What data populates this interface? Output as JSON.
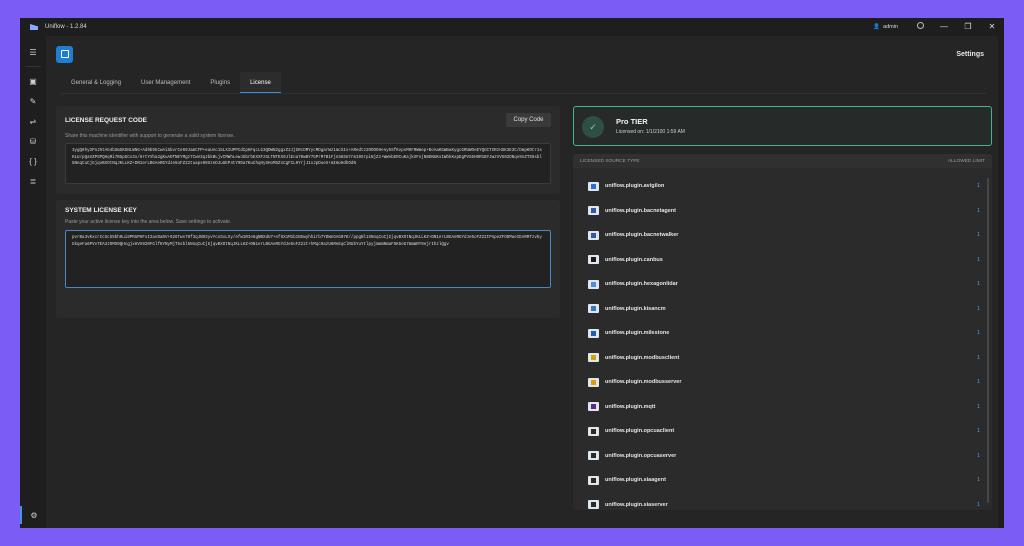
{
  "app": {
    "title": "Uniflow - 1.2.84"
  },
  "titlebar": {
    "user": "admin",
    "minimize": "—",
    "restore": "❐",
    "close": "✕"
  },
  "sidebar": {
    "items": [
      "☰",
      "▣",
      "✎",
      "⇌",
      "⛁",
      "{ }",
      "≣"
    ],
    "settings": "⚙"
  },
  "header": {
    "title": "Settings"
  },
  "tabs": [
    "General & Logging",
    "User Management",
    "Plugins",
    "License"
  ],
  "license_request": {
    "title": "LICENSE REQUEST CODE",
    "description": "Share this machine identifier with support to generate a valid system license.",
    "copy_label": "Copy Code",
    "code": "3ygQ8hy2PnJ5tAG4bSmGKGNLWNG+Ad9b9kCwAiSbvrCe69JamCFP+eaUAc15LXIUPPCdCpHFqcLG3QDWN2ggxZ2JjGRcDMYycMDgarWz1mcSIx+ARedtz2OOOOHeny5SfKvpsMHFRWmep+BoAaKGWmaKygcGRUWOeEYQGCTXRzHSK3E3C/DmpKOtr1sHLU/pQaVZPSPQHqRi7BSpGCs3x/6rtYVha2gKuAOTNEYMgz7CwV3qJbkBLjvCMWhLewJGbrbEXXFzGLTNTEX9JlEna70wBY7GPrM7B1FjnS6SU7rm19SrpiNjZz+WWnbERCuKajkXFnjNBDNUKsIWbkKxpEgPVS6HOR1BYJwzVVG02DNqv9nZT55sbl5NnqCuCjGjqvBXOtNqJKLLKZ+DN1erLBGAeRGYdJe5oFZ22tuaps99XzeDJuSEP4tY9Da7KuChqHySHoMSZxCgFCL0YrjJ1xJpDueX+mImoHdhOdN"
  },
  "system_key": {
    "title": "SYSTEM LICENSE KEY",
    "description": "Paste your active license key into the area below. Save settings to activate.",
    "key": "pvrBa3vKxcrIcScG5bh9ui9PRUPHFxI2avDaDV+926Tws70f3qJN93yvYcoSxLXy/efw1RIe6gNBXdU7+nf6X1M1b1NSwyhhirb7YDWnGAG07K//ppgNl1SNnqCuCjGjqvBXOtNqJKLLKZ+DN1erLBGAeRGYdJe5oFZ22tPnpeZFODMaeIEARRTzvbyGkqeFa6PVv7EA3JOMS0QHcgjxHVX920FGlfKYNyMjT5sbl5NnqCuCjGjqvBXOtNqJKLLKZ+DN1erLBGAeRGYdJe5oFZ22t+hMqc9azU6ReEqClRUbYuYtlpyjmmmNmaF5K5eG7mmmRY9ejrIhzlQgv"
  },
  "tier": {
    "name": "Pro TIER",
    "licensed": "Licensed on: 1/1/2100 1:59 AM",
    "check": "✓"
  },
  "sources": {
    "col_type": "LICENSED SOURCE TYPE",
    "col_limit": "ALLOWED LIMIT",
    "items": [
      {
        "name": "uniflow.plugin.avigilon",
        "limit": "1",
        "color": "#2a6fdb"
      },
      {
        "name": "uniflow.plugin.bacnetagent",
        "limit": "1",
        "color": "#3358a8"
      },
      {
        "name": "uniflow.plugin.bacnetwalker",
        "limit": "1",
        "color": "#3358a8"
      },
      {
        "name": "uniflow.plugin.canbus",
        "limit": "1",
        "color": "#1a1a1a"
      },
      {
        "name": "uniflow.plugin.hexagonlidar",
        "limit": "1",
        "color": "#4b8fd6"
      },
      {
        "name": "uniflow.plugin.kisancm",
        "limit": "1",
        "color": "#3a75c4"
      },
      {
        "name": "uniflow.plugin.milestone",
        "limit": "1",
        "color": "#1f5fb0"
      },
      {
        "name": "uniflow.plugin.modbusclient",
        "limit": "1",
        "color": "#d8a100"
      },
      {
        "name": "uniflow.plugin.modbusserver",
        "limit": "1",
        "color": "#d8a100"
      },
      {
        "name": "uniflow.plugin.mqtt",
        "limit": "1",
        "color": "#5a2d82"
      },
      {
        "name": "uniflow.plugin.opcuaclient",
        "limit": "1",
        "color": "#2a2a2a"
      },
      {
        "name": "uniflow.plugin.opcuaserver",
        "limit": "1",
        "color": "#2a2a2a"
      },
      {
        "name": "uniflow.plugin.siaagent",
        "limit": "1",
        "color": "#2a2a2a"
      },
      {
        "name": "uniflow.plugin.siaserver",
        "limit": "1",
        "color": "#2a2a2a"
      }
    ]
  }
}
